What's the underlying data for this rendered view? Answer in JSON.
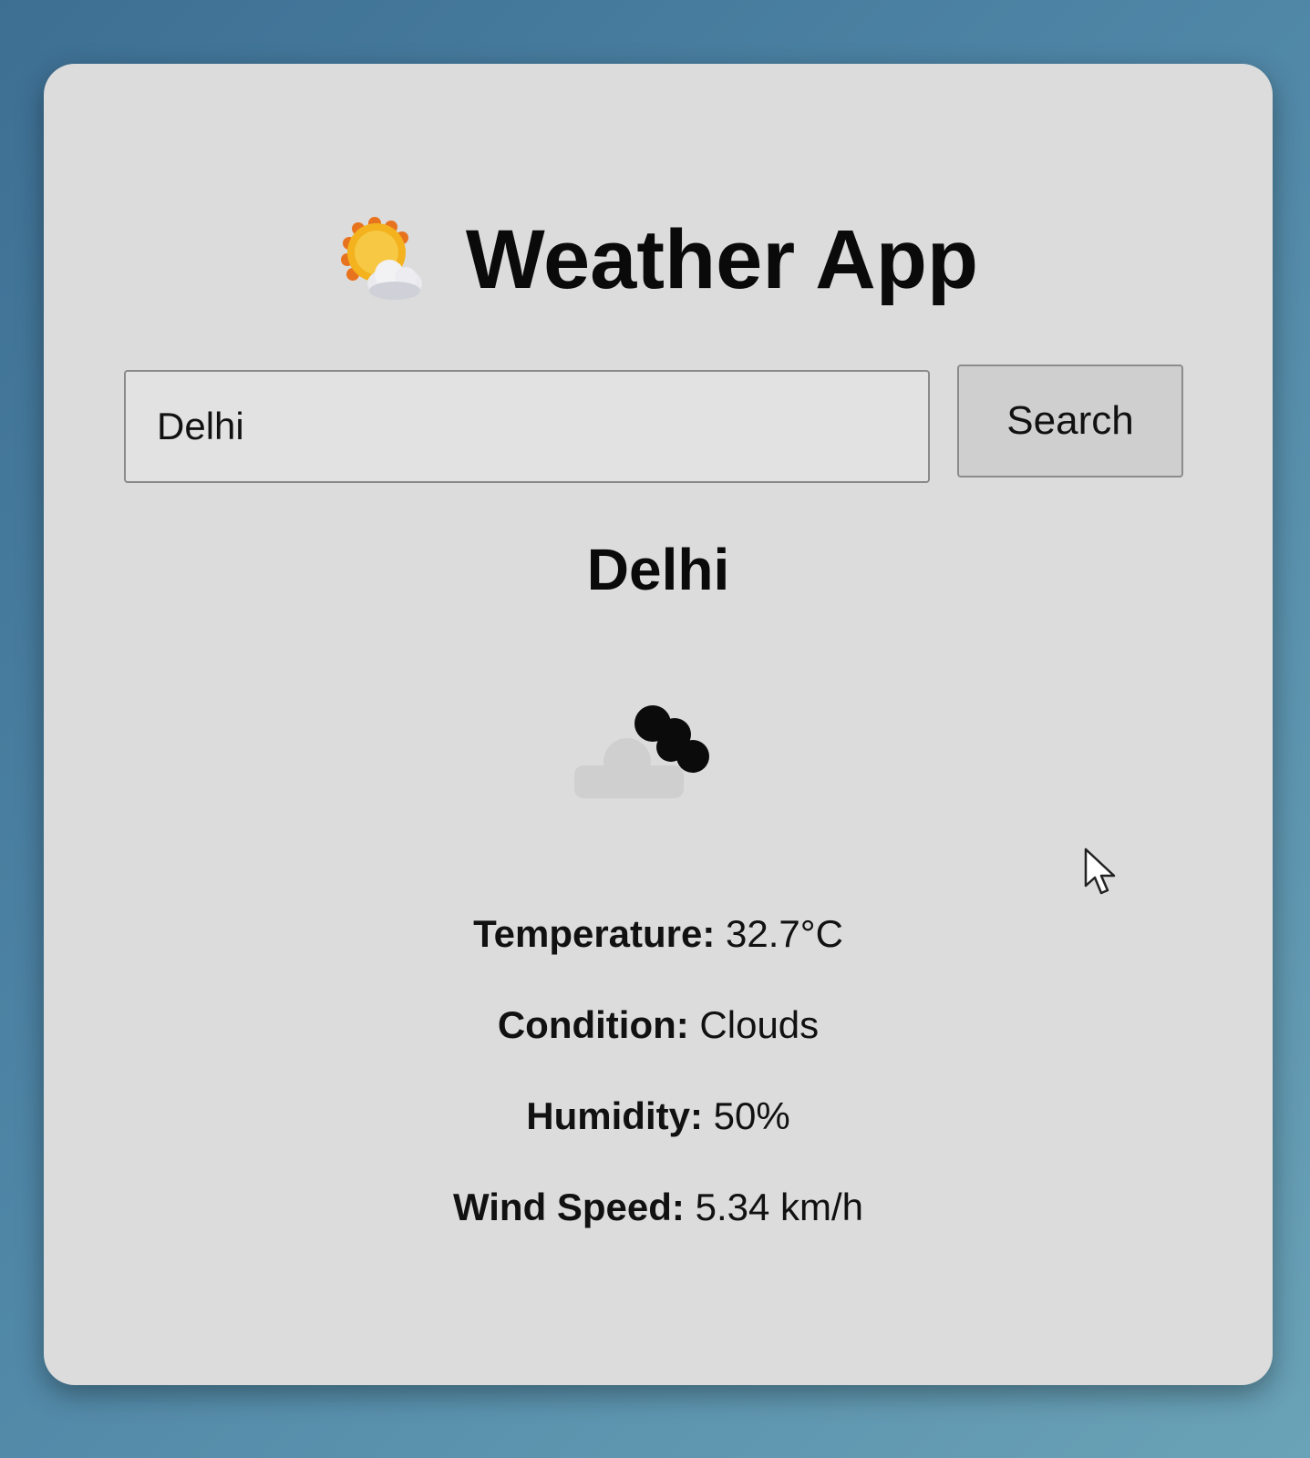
{
  "header": {
    "title": "Weather App",
    "icon": "sun-behind-cloud-icon"
  },
  "search": {
    "value": "Delhi",
    "button_label": "Search"
  },
  "result": {
    "city": "Delhi",
    "icon": "clouds-icon",
    "details": [
      {
        "label": "Temperature:",
        "value": "32.7°C"
      },
      {
        "label": "Condition:",
        "value": "Clouds"
      },
      {
        "label": "Humidity:",
        "value": "50%"
      },
      {
        "label": "Wind Speed:",
        "value": "5.34 km/h"
      }
    ]
  },
  "colors": {
    "background": "#4f86a6",
    "card": "#dcdcdc",
    "button": "#cfcfcf",
    "text": "#0a0a0a"
  }
}
